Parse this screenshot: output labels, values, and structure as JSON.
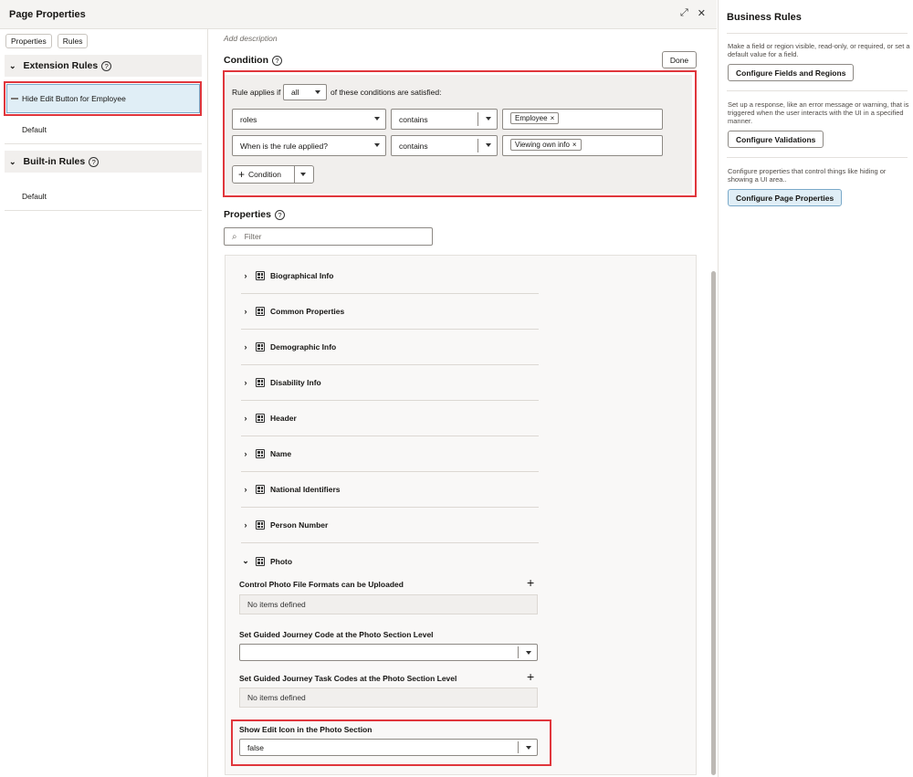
{
  "window": {
    "title": "Page Properties",
    "expand_icon": "expand-icon",
    "close_icon": "close-icon"
  },
  "sidebar": {
    "tabs": [
      "Properties",
      "Rules"
    ],
    "extension_rules": {
      "label": "Extension Rules",
      "help": "?"
    },
    "selected_rule": "Hide Edit Button for Employee",
    "extension_default": "Default",
    "builtin_rules": {
      "label": "Built-in Rules",
      "help": "?"
    },
    "builtin_default": "Default"
  },
  "main": {
    "add_description": "Add description",
    "condition_title": "Condition",
    "done_button": "Done",
    "rule_applies_prefix": "Rule applies if",
    "match_mode": "all",
    "rule_applies_suffix": "of these conditions are satisfied:",
    "conditions": [
      {
        "field": "roles",
        "operator": "contains",
        "value": "Employee"
      },
      {
        "field": "When is the rule applied?",
        "operator": "contains",
        "value": "Viewing own info"
      }
    ],
    "add_condition_button": "Condition",
    "properties_title": "Properties",
    "filter_placeholder": "Filter",
    "sections": [
      "Biographical Info",
      "Common Properties",
      "Demographic Info",
      "Disability Info",
      "Header",
      "Name",
      "National Identifiers",
      "Person Number",
      "Photo"
    ],
    "photo": {
      "file_formats_label": "Control Photo File Formats can be Uploaded",
      "file_formats_empty": "No items defined",
      "journey_code_label": "Set Guided Journey Code at the Photo Section Level",
      "journey_code_value": "",
      "journey_task_label": "Set Guided Journey Task Codes at the Photo Section Level",
      "journey_task_empty": "No items defined",
      "edit_icon_label": "Show Edit Icon in the Photo Section",
      "edit_icon_value": "false"
    }
  },
  "right_panel": {
    "title": "Business Rules",
    "blocks": [
      {
        "text": "Make a field or region visible, read-only, or required, or set a default value for a field.",
        "button": "Configure Fields and Regions"
      },
      {
        "text": "Set up a response, like an error message or warning, that is triggered when the user interacts with the UI in a specified manner.",
        "button": "Configure Validations"
      },
      {
        "text": "Configure properties that control things like hiding or showing a UI area..",
        "button": "Configure Page Properties"
      }
    ]
  },
  "colors": {
    "highlight_red": "#e0363c",
    "selected_bg": "#e0eef6",
    "panel_bg": "#f1efed"
  }
}
